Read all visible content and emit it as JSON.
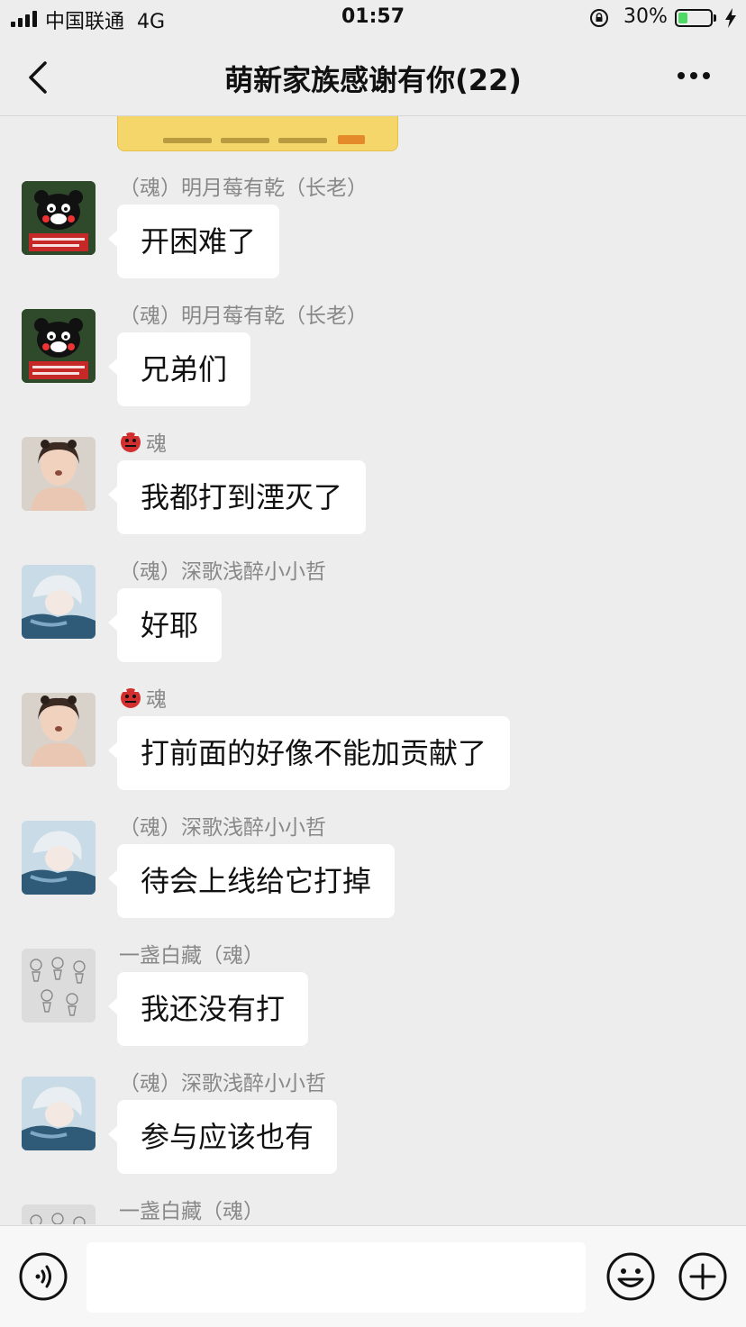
{
  "status_bar": {
    "carrier": "中国联通",
    "network": "4G",
    "time": "01:57",
    "battery_percent": "30%",
    "battery_level": 0.3
  },
  "header": {
    "title": "萌新家族感谢有你(22)"
  },
  "messages": [
    {
      "sender": "（魂）明月莓有乾（长老）",
      "text": "开困难了",
      "avatar": "kumamon"
    },
    {
      "sender": "（魂）明月莓有乾（长老）",
      "text": "兄弟们",
      "avatar": "kumamon"
    },
    {
      "sender": "魂",
      "sender_icon": "ogre-emoji",
      "text": "我都打到湮灭了",
      "avatar": "girl-photo"
    },
    {
      "sender": "（魂）深歌浅醉小小哲",
      "text": "好耶",
      "avatar": "anime-character"
    },
    {
      "sender": "魂",
      "sender_icon": "ogre-emoji",
      "text": "打前面的好像不能加贡献了",
      "avatar": "girl-photo"
    },
    {
      "sender": "（魂）深歌浅醉小小哲",
      "text": "待会上线给它打掉",
      "avatar": "anime-character"
    },
    {
      "sender": "一盏白藏（魂）",
      "text": "我还没有打",
      "avatar": "sketch"
    },
    {
      "sender": "（魂）深歌浅醉小小哲",
      "text": "参与应该也有",
      "avatar": "anime-character"
    },
    {
      "sender": "一盏白藏（魂）",
      "text": "",
      "avatar": "sketch"
    }
  ],
  "colors": {
    "background": "#ededed",
    "bubble": "#ffffff",
    "sender_name": "#888888",
    "battery_fill": "#4cd964"
  },
  "input_bar": {
    "value": "",
    "icons": [
      "voice-icon",
      "emoji-icon",
      "plus-icon"
    ]
  }
}
